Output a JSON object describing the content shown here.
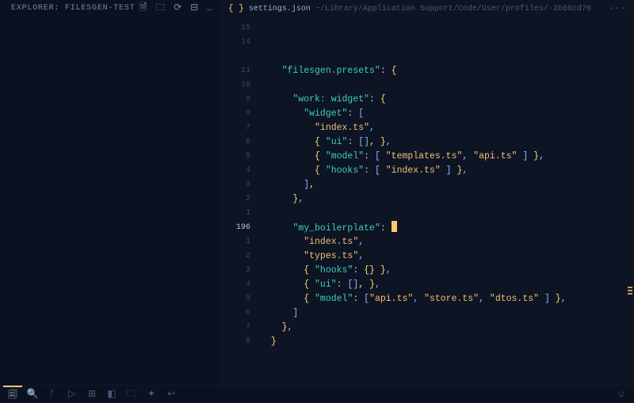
{
  "explorer": {
    "title": "EXPLORER: FILESGEN-TEST",
    "actions": [
      "new-file-icon",
      "new-folder-icon",
      "refresh-icon",
      "collapse-icon",
      "more-icon"
    ]
  },
  "tab": {
    "filename": "settings.json",
    "filepath": "~/Library/Application Support/Code/User/profiles/-2b66cd76"
  },
  "statusbar_icons": [
    "files-icon",
    "search-icon",
    "source-control-icon",
    "run-debug-icon",
    "extensions-icon",
    "layout-icon",
    "folder-icon",
    "lint-icon",
    "wrap-icon",
    "",
    "account-icon"
  ],
  "lines": [
    {
      "num": "15",
      "indent": 0,
      "tokens": []
    },
    {
      "num": "14",
      "indent": 0,
      "tokens": []
    },
    {
      "num": "",
      "indent": 0,
      "tokens": []
    },
    {
      "num": "11",
      "indent": 1,
      "tokens": [
        [
          "key",
          "\"filesgen.presets\""
        ],
        [
          "colon",
          ": "
        ],
        [
          "punc",
          "{"
        ]
      ]
    },
    {
      "num": "10",
      "indent": 0,
      "tokens": []
    },
    {
      "num": "9",
      "indent": 2,
      "tokens": [
        [
          "key",
          "\"work: widget\""
        ],
        [
          "colon",
          ": "
        ],
        [
          "punc",
          "{"
        ]
      ]
    },
    {
      "num": "8",
      "indent": 3,
      "tokens": [
        [
          "key",
          "\"widget\""
        ],
        [
          "colon",
          ": "
        ],
        [
          "brkt",
          "["
        ]
      ]
    },
    {
      "num": "7",
      "indent": 4,
      "tokens": [
        [
          "str",
          "\"index.ts\""
        ],
        [
          "brkt",
          ","
        ]
      ]
    },
    {
      "num": "6",
      "indent": 4,
      "tokens": [
        [
          "punc",
          "{ "
        ],
        [
          "key",
          "\"ui\""
        ],
        [
          "colon",
          ": "
        ],
        [
          "brkt",
          "[]"
        ],
        [
          "punc",
          ", }"
        ],
        [
          "brkt",
          ","
        ]
      ]
    },
    {
      "num": "5",
      "indent": 4,
      "tokens": [
        [
          "punc",
          "{ "
        ],
        [
          "key",
          "\"model\""
        ],
        [
          "colon",
          ": "
        ],
        [
          "brkt",
          "[ "
        ],
        [
          "str",
          "\"templates.ts\""
        ],
        [
          "brkt",
          ", "
        ],
        [
          "str",
          "\"api.ts\""
        ],
        [
          "brkt",
          " ] "
        ],
        [
          "punc",
          "}"
        ],
        [
          "brkt",
          ","
        ]
      ]
    },
    {
      "num": "4",
      "indent": 4,
      "tokens": [
        [
          "punc",
          "{ "
        ],
        [
          "key",
          "\"hooks\""
        ],
        [
          "colon",
          ": "
        ],
        [
          "brkt",
          "[ "
        ],
        [
          "str",
          "\"index.ts\""
        ],
        [
          "brkt",
          " ] "
        ],
        [
          "punc",
          "}"
        ],
        [
          "brkt",
          ","
        ]
      ]
    },
    {
      "num": "3",
      "indent": 3,
      "tokens": [
        [
          "brkt",
          "]"
        ],
        [
          "punc",
          ","
        ]
      ]
    },
    {
      "num": "2",
      "indent": 2,
      "tokens": [
        [
          "punc",
          "}"
        ],
        [
          "brkt",
          ","
        ]
      ]
    },
    {
      "num": "1",
      "indent": 0,
      "tokens": []
    },
    {
      "num": "196",
      "indent": 2,
      "current": true,
      "tokens": [
        [
          "key",
          "\"my_boilerplate\""
        ],
        [
          "colon",
          ": "
        ],
        [
          "cursor",
          ""
        ]
      ]
    },
    {
      "num": "1",
      "indent": 3,
      "tokens": [
        [
          "str",
          "\"index.ts\""
        ],
        [
          "brkt",
          ","
        ]
      ]
    },
    {
      "num": "2",
      "indent": 3,
      "tokens": [
        [
          "str",
          "\"types.ts\""
        ],
        [
          "brkt",
          ","
        ]
      ]
    },
    {
      "num": "3",
      "indent": 3,
      "tokens": [
        [
          "punc",
          "{ "
        ],
        [
          "key",
          "\"hooks\""
        ],
        [
          "colon",
          ": "
        ],
        [
          "punc",
          "{} }"
        ],
        [
          "brkt",
          ","
        ]
      ]
    },
    {
      "num": "4",
      "indent": 3,
      "tokens": [
        [
          "punc",
          "{ "
        ],
        [
          "key",
          "\"ui\""
        ],
        [
          "colon",
          ": "
        ],
        [
          "brkt",
          "[]"
        ],
        [
          "punc",
          ", }"
        ],
        [
          "brkt",
          ","
        ]
      ]
    },
    {
      "num": "5",
      "indent": 3,
      "tokens": [
        [
          "punc",
          "{ "
        ],
        [
          "key",
          "\"model\""
        ],
        [
          "colon",
          ": "
        ],
        [
          "brkt",
          "["
        ],
        [
          "str",
          "\"api.ts\""
        ],
        [
          "brkt",
          ", "
        ],
        [
          "str",
          "\"store.ts\""
        ],
        [
          "brkt",
          ", "
        ],
        [
          "str",
          "\"dtos.ts\""
        ],
        [
          "brkt",
          " ] "
        ],
        [
          "punc",
          "}"
        ],
        [
          "brkt",
          ","
        ]
      ]
    },
    {
      "num": "6",
      "indent": 2,
      "tokens": [
        [
          "brkt2",
          "]"
        ]
      ]
    },
    {
      "num": "7",
      "indent": 1,
      "tokens": [
        [
          "punc",
          "}"
        ],
        [
          "brkt",
          ","
        ]
      ]
    },
    {
      "num": "8",
      "indent": 0,
      "tokens": [
        [
          "punc",
          "}"
        ]
      ]
    }
  ]
}
